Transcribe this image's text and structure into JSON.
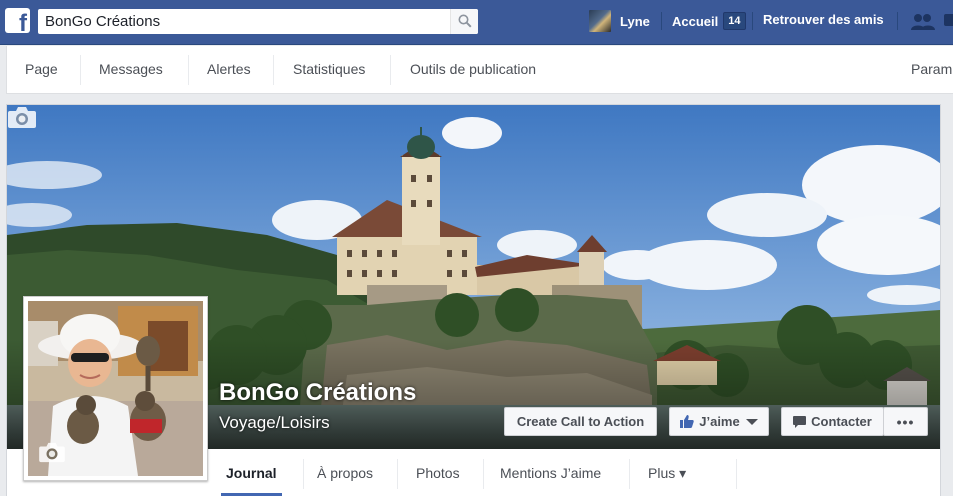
{
  "topbar": {
    "search_value": "BonGo Créations",
    "user_name": "Lyne",
    "home_label": "Accueil",
    "home_count": "14",
    "find_friends_label": "Retrouver des amis"
  },
  "admin_nav": {
    "items": [
      "Page",
      "Messages",
      "Alertes",
      "Statistiques",
      "Outils de publication"
    ],
    "settings_label": "Param"
  },
  "page": {
    "name": "BonGo Créations",
    "category": "Voyage/Loisirs"
  },
  "actions": {
    "cta_label": "Create Call to Action",
    "like_label": "J’aime",
    "contact_label": "Contacter",
    "more_label": "•••"
  },
  "tabs": {
    "journal": "Journal",
    "about": "À propos",
    "photos": "Photos",
    "likes": "Mentions J’aime",
    "more": "Plus ▾"
  },
  "colors": {
    "brand_blue": "#3b5998",
    "active_tab_underline": "#4267b2"
  }
}
